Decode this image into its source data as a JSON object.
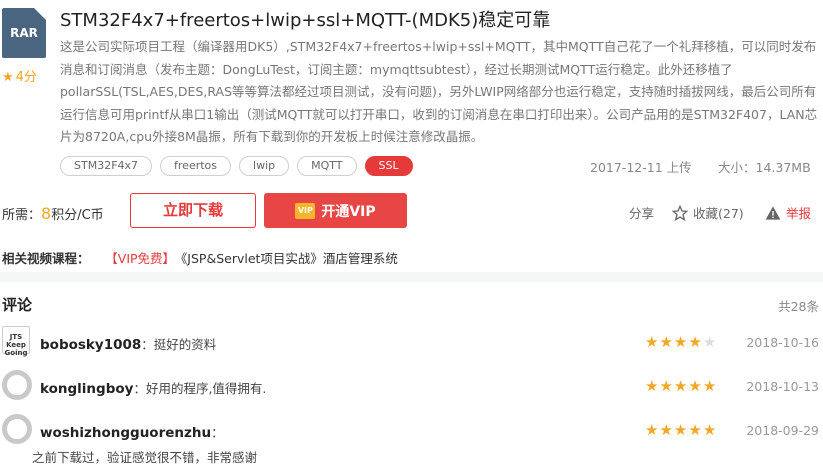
{
  "resource": {
    "file_ext": "RAR",
    "score": "4分",
    "title": "STM32F4x7+freertos+lwip+ssl+MQTT-(MDK5)稳定可靠",
    "description": "这是公司实际项目工程（编译器用DK5）,STM32F4x7+freertos+lwip+ssl+MQTT，其中MQTT自己花了一个礼拜移植，可以同时发布消息和订阅消息（发布主题：DongLuTest，订阅主题：mymqttsubtest），经过长期测试MQTT运行稳定。此外还移植了pollarSSL(TSL,AES,DES,RAS等等算法都经过项目测试，没有问题)，另外LWIP网络部分也运行稳定，支持随时插拔网线，最后公司所有运行信息可用printf从串口1输出（测试MQTT就可以打开串口，收到的订阅消息在串口打印出来）。公司产品用的是STM32F407，LAN芯片为8720A,cpu外接8M晶振，所有下载到你的开发板上时候注意修改晶振。",
    "tags": [
      "STM32F4x7",
      "freertos",
      "lwip",
      "MQTT",
      "SSL"
    ],
    "upload_date": "2017-12-11 上传",
    "size": "大小：14.37MB"
  },
  "purchase": {
    "price_prefix": "所需：",
    "price_value": "8",
    "price_unit": "积分/C币",
    "download_label": "立即下载",
    "vip_badge": "VIP",
    "vip_label": "开通VIP",
    "share_label": "分享",
    "favorite_label": "收藏(27)",
    "report_label": "举报"
  },
  "related": {
    "label": "相关视频课程：",
    "vip_free": "【VIP免费】",
    "course": "《JSP&Servlet项目实战》酒店管理系统"
  },
  "comments": {
    "title": "评论",
    "count": "共28条",
    "items": [
      {
        "user": "bobosky1008",
        "text": "：挺好的资料",
        "rating": 4,
        "date": "2018-10-16",
        "avatar_text": "JTS Keep Going"
      },
      {
        "user": "konglingboy",
        "text": "：好用的程序,值得拥有.",
        "rating": 5,
        "date": "2018-10-13"
      },
      {
        "user": "woshizhongguorenzhu",
        "text": "：",
        "rating": 5,
        "date": "2018-09-29",
        "body": "之前下载过，验证感觉很不错，非常感谢"
      }
    ]
  },
  "colors": {
    "accent": "#e63a3a",
    "star": "#f5a623",
    "file_icon": "#4a6580"
  }
}
